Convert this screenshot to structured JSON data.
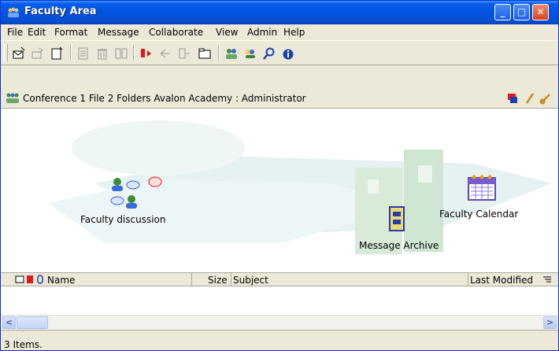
{
  "window": {
    "title": "Faculty Area",
    "minimize": "_",
    "maximize": "□",
    "close": "✕"
  },
  "menu": [
    "File",
    "Edit",
    "Format",
    "Message",
    "Collaborate",
    "View",
    "Admin",
    "Help"
  ],
  "toolbar": {
    "icons": [
      "new-message-icon",
      "reply-icon",
      "new-document-icon",
      "edit-icon",
      "delete-icon",
      "move-icon",
      "send-flag-icon",
      "forward-icon",
      "reply-all-icon",
      "folder-icon",
      "people-icon",
      "who-icon",
      "find-icon",
      "info-icon"
    ]
  },
  "infobar": {
    "text": "Conference   1 File  2 Folders   Avalon Academy : Administrator",
    "icons": [
      "conference-icon",
      "flag-icon",
      "pencil-icon",
      "key-icon"
    ]
  },
  "canvas": {
    "items": [
      {
        "label": "Faculty discussion",
        "icon": "discussion-icon"
      },
      {
        "label": "Message Archive",
        "icon": "archive-cabinet-icon"
      },
      {
        "label": "Faculty Calendar",
        "icon": "calendar-icon"
      }
    ]
  },
  "columns": {
    "name": "Name",
    "size": "Size",
    "subject": "Subject",
    "last_modified": "Last Modified"
  },
  "scroll": {
    "left": "<",
    "right": ">"
  },
  "status": {
    "text": "3 Items."
  },
  "colors": {
    "title_bar": "#0053e1",
    "chrome": "#ece9d8"
  }
}
